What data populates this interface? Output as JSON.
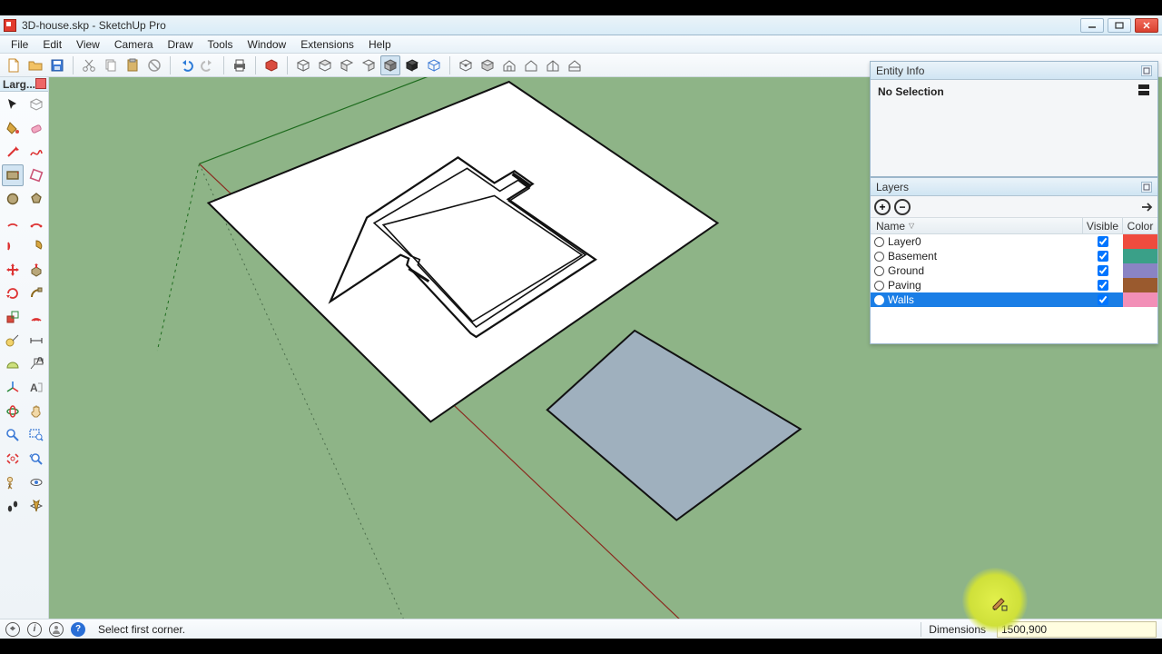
{
  "title": "3D-house.skp - SketchUp Pro",
  "menu": [
    "File",
    "Edit",
    "View",
    "Camera",
    "Draw",
    "Tools",
    "Window",
    "Extensions",
    "Help"
  ],
  "toolbar_left_title": "Larg...",
  "entity_panel": {
    "title": "Entity Info",
    "status": "No Selection"
  },
  "layers_panel": {
    "title": "Layers",
    "columns": {
      "name": "Name",
      "visible": "Visible",
      "color": "Color"
    },
    "rows": [
      {
        "name": "Layer0",
        "active": false,
        "visible": true,
        "color": "#ef4b3e",
        "selected": false
      },
      {
        "name": "Basement",
        "active": false,
        "visible": true,
        "color": "#3aa088",
        "selected": false
      },
      {
        "name": "Ground",
        "active": false,
        "visible": true,
        "color": "#8a84c4",
        "selected": false
      },
      {
        "name": "Paving",
        "active": false,
        "visible": true,
        "color": "#9a5a2e",
        "selected": false
      },
      {
        "name": "Walls",
        "active": true,
        "visible": true,
        "color": "#f28fb7",
        "selected": true
      }
    ]
  },
  "status": {
    "hint": "Select first corner.",
    "dim_label": "Dimensions",
    "dim_value": "1500,900"
  }
}
